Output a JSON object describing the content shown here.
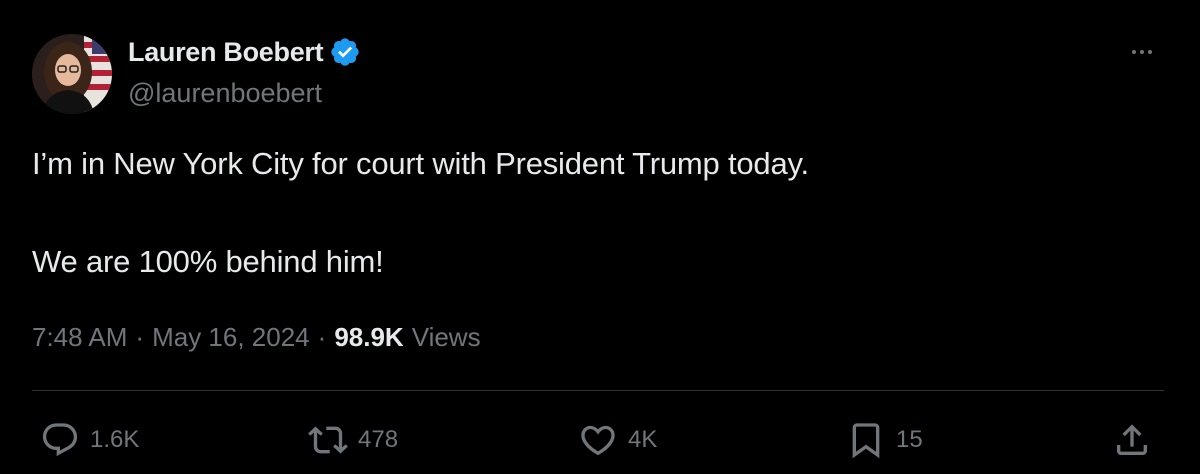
{
  "author": {
    "display_name": "Lauren Boebert",
    "handle": "@laurenboebert",
    "verified": true
  },
  "tweet": {
    "line1": "I’m in New York City for court with President Trump today.",
    "line2": "We are 100% behind him!",
    "time": "7:48 AM",
    "date": "May 16, 2024",
    "separator": "·",
    "views_count": "98.9K",
    "views_label": "Views"
  },
  "actions": {
    "reply_count": "1.6K",
    "repost_count": "478",
    "like_count": "4K",
    "bookmark_count": "15"
  },
  "icons": [
    "more-icon",
    "verified-icon",
    "reply-icon",
    "repost-icon",
    "like-icon",
    "bookmark-icon",
    "share-icon"
  ],
  "colors": {
    "background": "#000000",
    "text_primary": "#e7e9ea",
    "text_secondary": "#71767b",
    "verified_blue": "#1d9bf0",
    "divider": "#2f3336"
  }
}
